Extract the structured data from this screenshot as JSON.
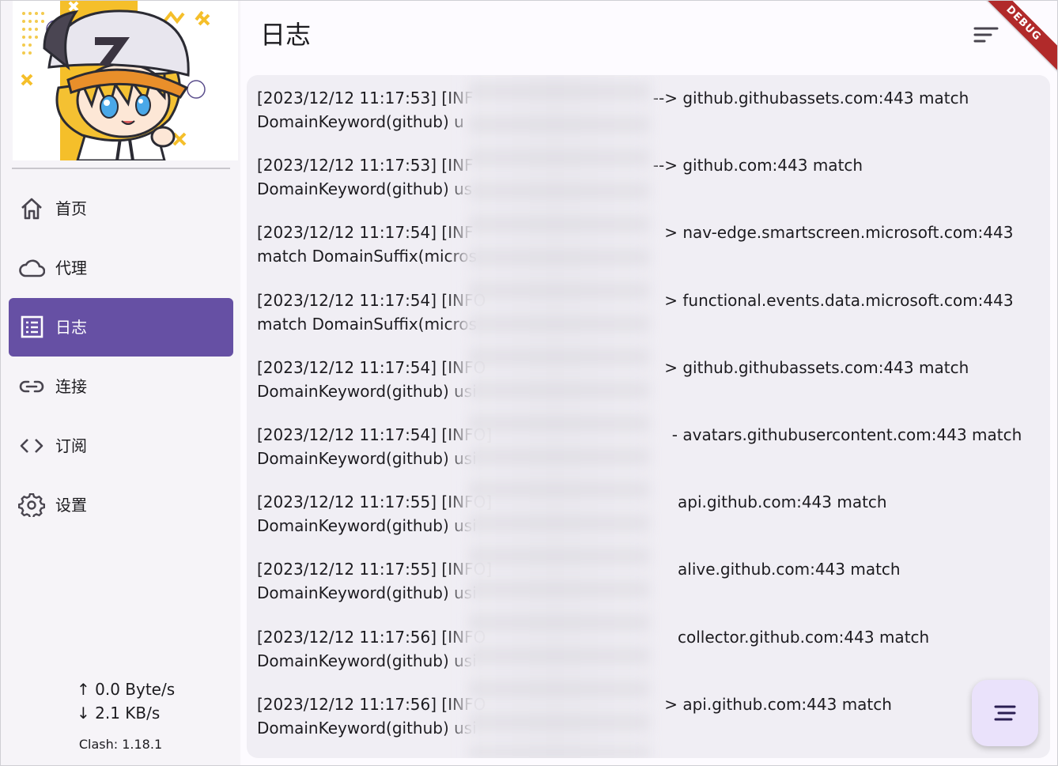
{
  "header": {
    "title": "日志"
  },
  "debug_banner": "DEBUG",
  "sidebar": {
    "items": [
      {
        "label": "首页",
        "icon": "home-icon",
        "active": false
      },
      {
        "label": "代理",
        "icon": "cloud-icon",
        "active": false
      },
      {
        "label": "日志",
        "icon": "list-icon",
        "active": true
      },
      {
        "label": "连接",
        "icon": "link-icon",
        "active": false
      },
      {
        "label": "订阅",
        "icon": "code-icon",
        "active": false
      },
      {
        "label": "设置",
        "icon": "gear-icon",
        "active": false
      }
    ],
    "upload_speed": "↑ 0.0 Byte/s",
    "download_speed": "↓ 2.1 KB/s",
    "version": "Clash: 1.18.1"
  },
  "logs": [
    {
      "timestamp": "[2023/12/12 11:17:53] [INF",
      "target": "--> github.githubassets.com:443 match",
      "rule": "DomainKeyword(github) u"
    },
    {
      "timestamp": "[2023/12/12 11:17:53] [INF",
      "target": "--> github.com:443 match",
      "rule": "DomainKeyword(github) us"
    },
    {
      "timestamp": "[2023/12/12 11:17:54] [INF",
      "target": "> nav-edge.smartscreen.microsoft.com:443",
      "rule": "match DomainSuffix(micros"
    },
    {
      "timestamp": "[2023/12/12 11:17:54] [INFO",
      "target": "> functional.events.data.microsoft.com:443",
      "rule": "match DomainSuffix(micros"
    },
    {
      "timestamp": "[2023/12/12 11:17:54] [INFO",
      "target": "> github.githubassets.com:443 match",
      "rule": "DomainKeyword(github) usi"
    },
    {
      "timestamp": "[2023/12/12 11:17:54] [INFO]",
      "target": "- avatars.githubusercontent.com:443 match",
      "rule": "DomainKeyword(github) usi"
    },
    {
      "timestamp": "[2023/12/12 11:17:55] [INFO]",
      "target": "api.github.com:443 match",
      "rule": "DomainKeyword(github) usi"
    },
    {
      "timestamp": "[2023/12/12 11:17:55] [INFO]",
      "target": "alive.github.com:443 match",
      "rule": "DomainKeyword(github) usi"
    },
    {
      "timestamp": "[2023/12/12 11:17:56] [INFO",
      "target": "collector.github.com:443 match",
      "rule": "DomainKeyword(github) usi"
    },
    {
      "timestamp": "[2023/12/12 11:17:56] [INFO",
      "target": "> api.github.com:443 match",
      "rule": "DomainKeyword(github) usi"
    }
  ],
  "colors": {
    "accent": "#6650a4",
    "panel": "#f0eef4",
    "fab": "#eae2fb",
    "debug": "#b12a2a"
  }
}
